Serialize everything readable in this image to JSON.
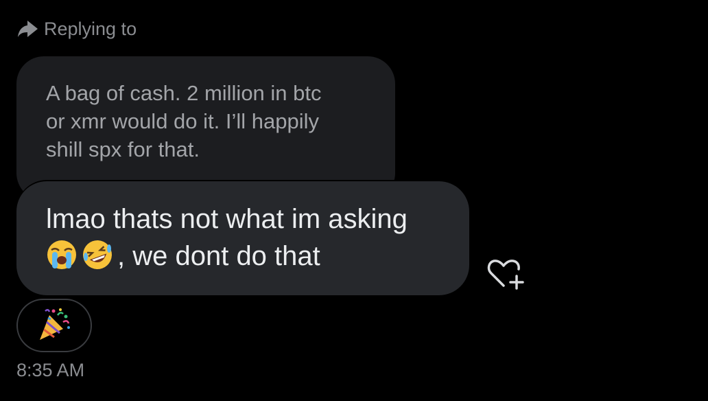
{
  "reply_header": {
    "label": "Replying to",
    "icon": "reply-arrow-icon"
  },
  "quoted_message": {
    "text": "A bag of cash. 2 million in btc\nor xmr would do it. I’ll happily\nshill spx for that."
  },
  "main_message": {
    "line1": "lmao thats not what im asking",
    "emoji_1": "crying-face-emoji",
    "emoji_2": "rolling-laughing-face-emoji",
    "line2_text": ", we dont do that"
  },
  "react_button": {
    "icon": "heart-plus-icon"
  },
  "reaction": {
    "emoji": "party-popper-emoji"
  },
  "timestamp": "8:35 AM",
  "colors": {
    "background": "#000000",
    "quoted_bubble": "#1c1d20",
    "main_bubble": "#26282c",
    "muted_text": "#8b8d91"
  }
}
